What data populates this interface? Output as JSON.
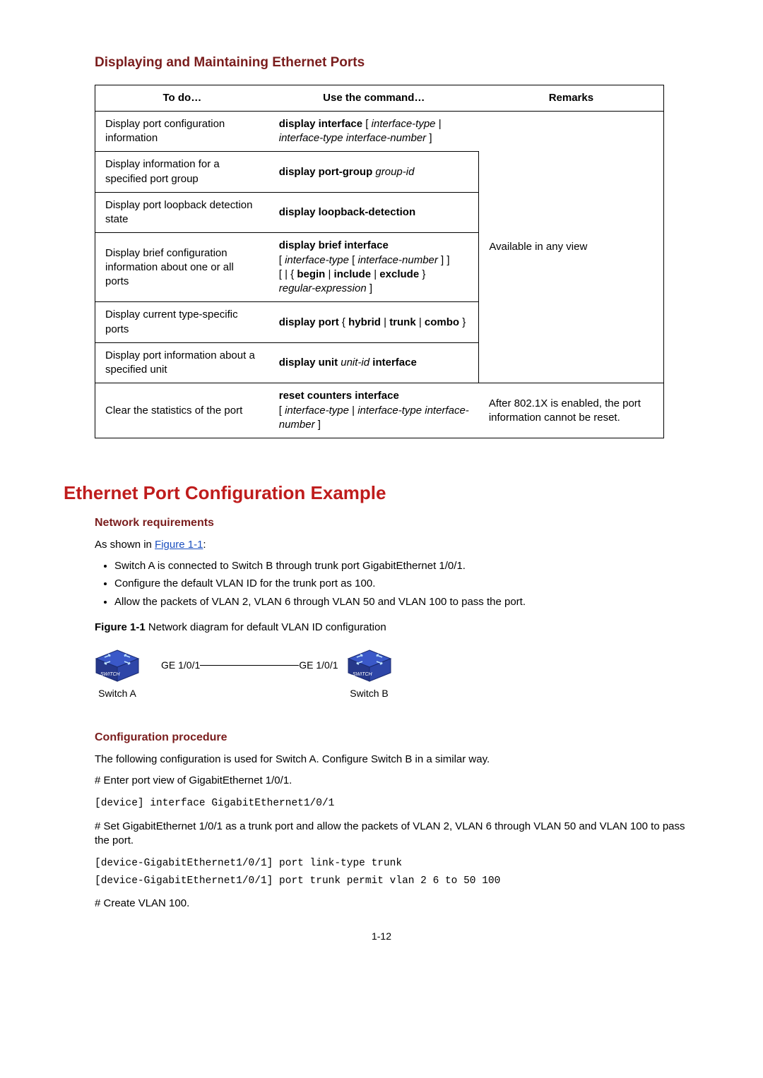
{
  "sec1_title": "Displaying and Maintaining Ethernet Ports",
  "table": {
    "head": {
      "c1": "To do…",
      "c2": "Use the command…",
      "c3": "Remarks"
    },
    "r1c1": "Display port configuration information",
    "r1c2a": "display interface",
    "r1c2b": " [ ",
    "r1c2c": "interface-type",
    "r1c2d": " | ",
    "r1c2e": "interface-type interface-number",
    "r1c2f": " ]",
    "r2c1": "Display information for a specified port group",
    "r2c2a": "display port-group",
    "r2c2b": " ",
    "r2c2c": "group-id",
    "r3c1": "Display port loopback detection state",
    "r3c2a": "display loopback-detection",
    "r4c1": "Display brief configuration information about one or all ports",
    "r4c2a": "display brief interface",
    "r4c2b": "[ ",
    "r4c2c": "interface-type",
    "r4c2d": " [ ",
    "r4c2e": "interface-number",
    "r4c2f": " ] ]",
    "r4c2g": "[ | { ",
    "r4c2h": "begin",
    "r4c2i": " | ",
    "r4c2j": "include",
    "r4c2k": " | ",
    "r4c2l": "exclude",
    "r4c2m": " } ",
    "r4c2n": "regular-expression",
    "r4c2o": " ]",
    "merged_remark": "Available in any view",
    "r5c1": "Display current type-specific ports",
    "r5c2a": "display port",
    "r5c2b": " { ",
    "r5c2c": "hybrid",
    "r5c2d": " | ",
    "r5c2e": "trunk",
    "r5c2f": " | ",
    "r5c2g": "combo",
    "r5c2h": " }",
    "r6c1": "Display port information about a specified unit",
    "r6c2a": "display unit",
    "r6c2b": " ",
    "r6c2c": "unit-id",
    "r6c2d": " ",
    "r6c2e": "interface",
    "r7c1": "Clear the statistics of the port",
    "r7c2a": "reset counters interface",
    "r7c2b": "[ ",
    "r7c2c": "interface-type",
    "r7c2d": " | ",
    "r7c2e": "interface-type interface-number",
    "r7c2f": " ]",
    "r7c3": "After 802.1X is enabled, the port information cannot be reset."
  },
  "sec2_title": "Ethernet Port Configuration Example",
  "netreq": {
    "title": "Network requirements",
    "intro_a": "As shown in ",
    "intro_link": "Figure 1-1",
    "intro_b": ":",
    "b1": "Switch A is connected to Switch B through trunk port GigabitEthernet 1/0/1.",
    "b2": "Configure the default VLAN ID for the trunk port as 100.",
    "b3": "Allow the packets of VLAN 2, VLAN 6 through VLAN 50 and VLAN 100 to pass the port."
  },
  "fig": {
    "label_bold": "Figure 1-1",
    "label_rest": " Network diagram for default VLAN ID configuration",
    "portA": "GE 1/0/1",
    "portB": "GE 1/0/1",
    "swA": "Switch A",
    "swB": "Switch B",
    "icon_text": "SWITCH"
  },
  "cfg": {
    "title": "Configuration procedure",
    "p1": "The following configuration is used for Switch A. Configure Switch B in a similar way.",
    "p2": "# Enter port view of GigabitEthernet 1/0/1.",
    "code1": "[device] interface GigabitEthernet1/0/1",
    "p3": "# Set GigabitEthernet 1/0/1 as a trunk port and allow the packets of VLAN 2, VLAN 6 through VLAN 50 and VLAN 100 to pass the port.",
    "code2": "[device-GigabitEthernet1/0/1] port link-type trunk\n[device-GigabitEthernet1/0/1] port trunk permit vlan 2 6 to 50 100",
    "p4": "# Create VLAN 100."
  },
  "page_num": "1-12"
}
